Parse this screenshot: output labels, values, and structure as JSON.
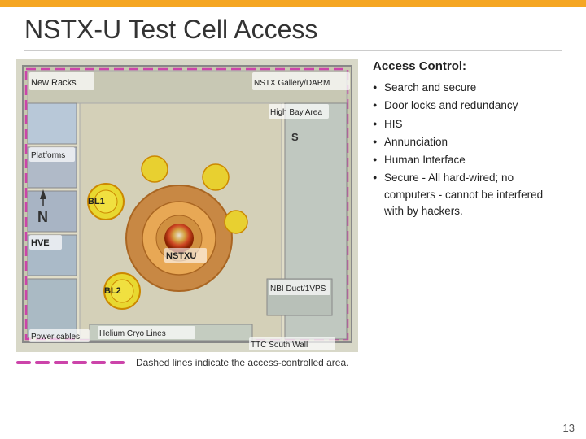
{
  "topbar": {
    "color": "#F5A623"
  },
  "title": "NSTX-U Test Cell Access",
  "divider": true,
  "access_control": {
    "heading": "Access Control:",
    "bullets": [
      "Search and secure",
      "Door locks and redundancy",
      "HIS",
      "Annunciation",
      "Human Interface",
      "Secure - All hard-wired; no computers - cannot be interfered with by hackers."
    ]
  },
  "caption": "Dashed lines indicate the access-controlled area.",
  "labels": {
    "new_racks": "New Racks",
    "bl1": "BL1",
    "bl2": "BL2",
    "platforms": "Platforms",
    "hve": "HVE",
    "nstx_gallery": "NSTX Gallery/DARM",
    "high_bay": "High Bay Area",
    "nstxu": "NSTXU",
    "nbi_duct": "NBI Duct/1VPS",
    "helium_cryo": "Helium Cryo Lines",
    "ttc_south": "TTC South Wall",
    "power_cables": "Power cables"
  },
  "page_number": "13"
}
